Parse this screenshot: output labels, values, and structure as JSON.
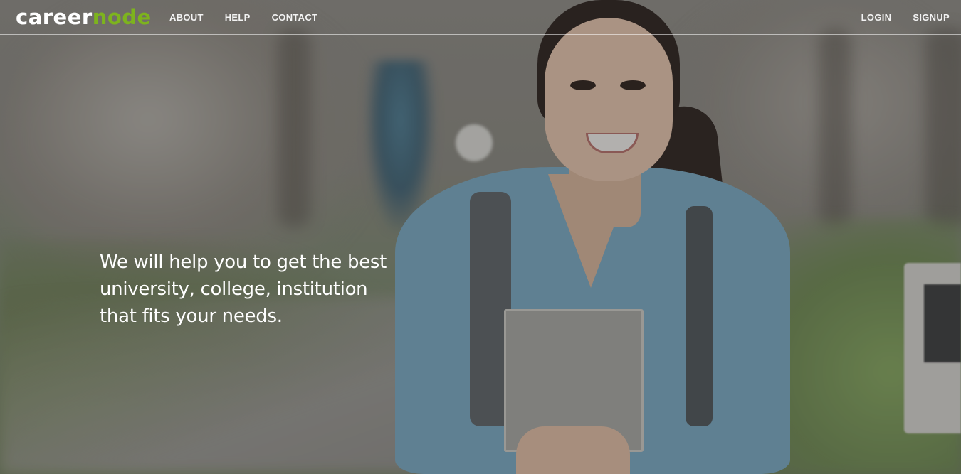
{
  "brand": {
    "logo_part1": "career",
    "logo_part2": "node",
    "accent_color": "#7db31e"
  },
  "nav": {
    "left": [
      {
        "label": "ABOUT"
      },
      {
        "label": "HELP"
      },
      {
        "label": "CONTACT"
      }
    ],
    "right": [
      {
        "label": "LOGIN"
      },
      {
        "label": "SIGNUP"
      }
    ]
  },
  "hero": {
    "headline": "We will help you to get the best university, college, institution that fits your needs.",
    "background_image": "student-with-backpack-holding-book-on-campus-path"
  }
}
